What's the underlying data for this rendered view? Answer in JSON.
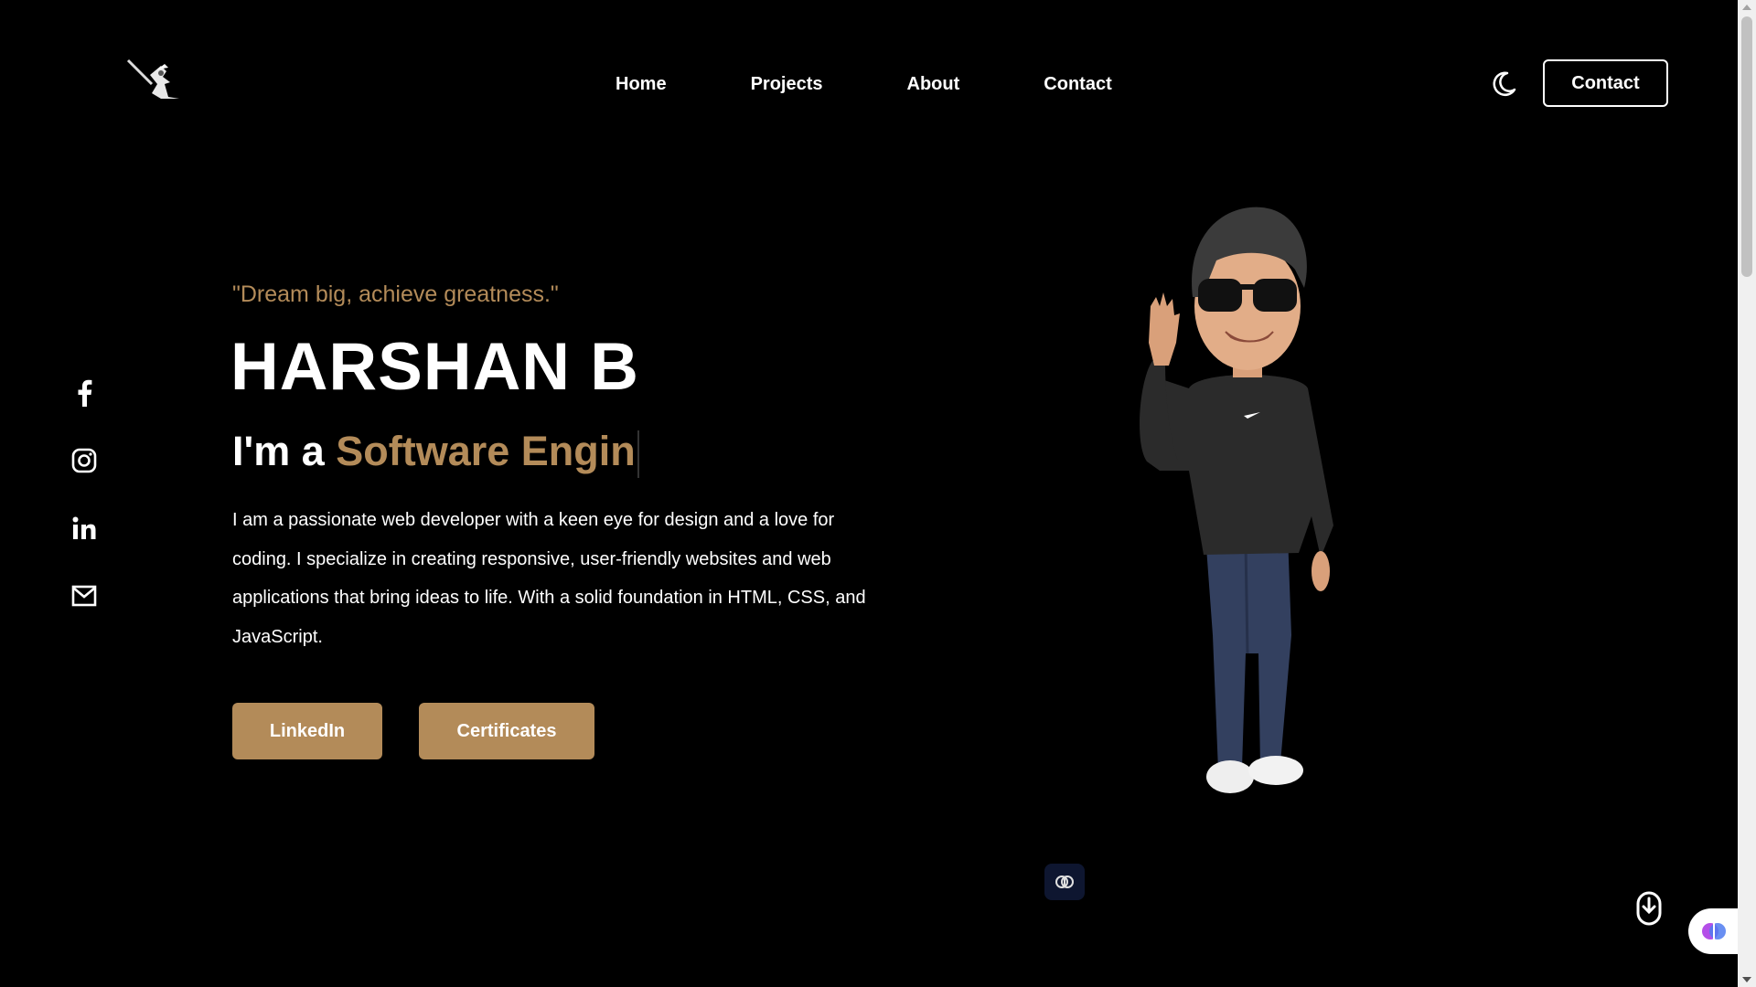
{
  "header": {
    "logo_icon": "samurai-logo",
    "nav": [
      {
        "label": "Home"
      },
      {
        "label": "Projects"
      },
      {
        "label": "About"
      },
      {
        "label": "Contact"
      }
    ],
    "theme_icon": "moon-icon",
    "contact_button": "Contact"
  },
  "social": [
    {
      "icon": "facebook-icon"
    },
    {
      "icon": "instagram-icon"
    },
    {
      "icon": "linkedin-icon"
    },
    {
      "icon": "mail-icon"
    }
  ],
  "hero": {
    "quote": "\"Dream big, achieve greatness.\"",
    "name": "HARSHAN B",
    "role_prefix": "I'm a ",
    "role_typed": "Software Engin",
    "description": "I am a passionate web developer with a keen eye for design and a love for coding. I specialize in creating responsive, user-friendly websites and web applications that bring ideas to life. With a solid foundation in HTML, CSS, and JavaScript.",
    "buttons": {
      "linkedin": "LinkedIn",
      "certificates": "Certificates"
    }
  },
  "colors": {
    "accent": "#b38b59",
    "background": "#000000",
    "text": "#ffffff"
  }
}
